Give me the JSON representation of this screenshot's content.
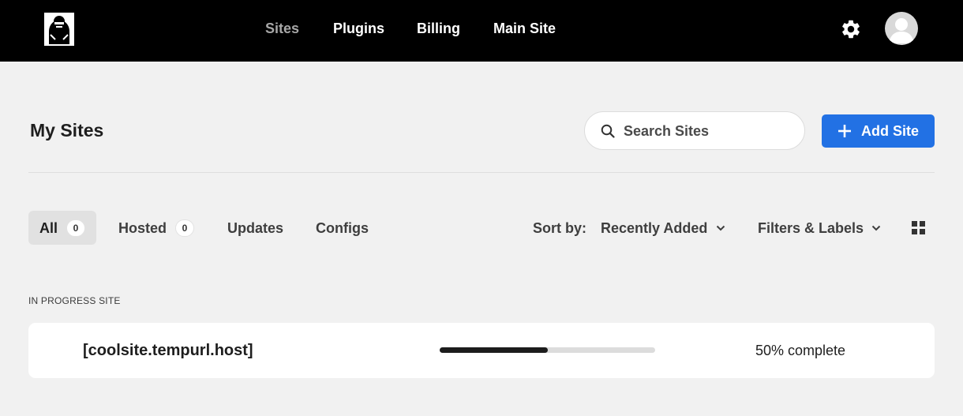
{
  "nav": {
    "items": [
      {
        "label": "Sites",
        "active": true
      },
      {
        "label": "Plugins",
        "active": false
      },
      {
        "label": "Billing",
        "active": false
      },
      {
        "label": "Main Site",
        "active": false
      }
    ],
    "icons": {
      "logo": "gorilla-logo",
      "settings": "gear-icon",
      "user": "user-avatar"
    }
  },
  "page": {
    "title": "My Sites",
    "search": {
      "placeholder": "Search Sites",
      "value": ""
    },
    "add_button": {
      "label": "Add Site"
    }
  },
  "tabs": [
    {
      "label": "All",
      "count": "0",
      "active": true
    },
    {
      "label": "Hosted",
      "count": "0",
      "active": false
    },
    {
      "label": "Updates",
      "active": false
    },
    {
      "label": "Configs",
      "active": false
    }
  ],
  "toolbar": {
    "sort_label": "Sort by:",
    "sort_value": "Recently Added",
    "filters_label": "Filters & Labels"
  },
  "in_progress": {
    "section_label": "IN PROGRESS SITE",
    "site_name": "[coolsite.tempurl.host]",
    "progress": 0.5,
    "progress_text": "50% complete"
  },
  "colors": {
    "accent": "#2271e4",
    "topbar": "#000000",
    "background": "#f1f1f1"
  }
}
